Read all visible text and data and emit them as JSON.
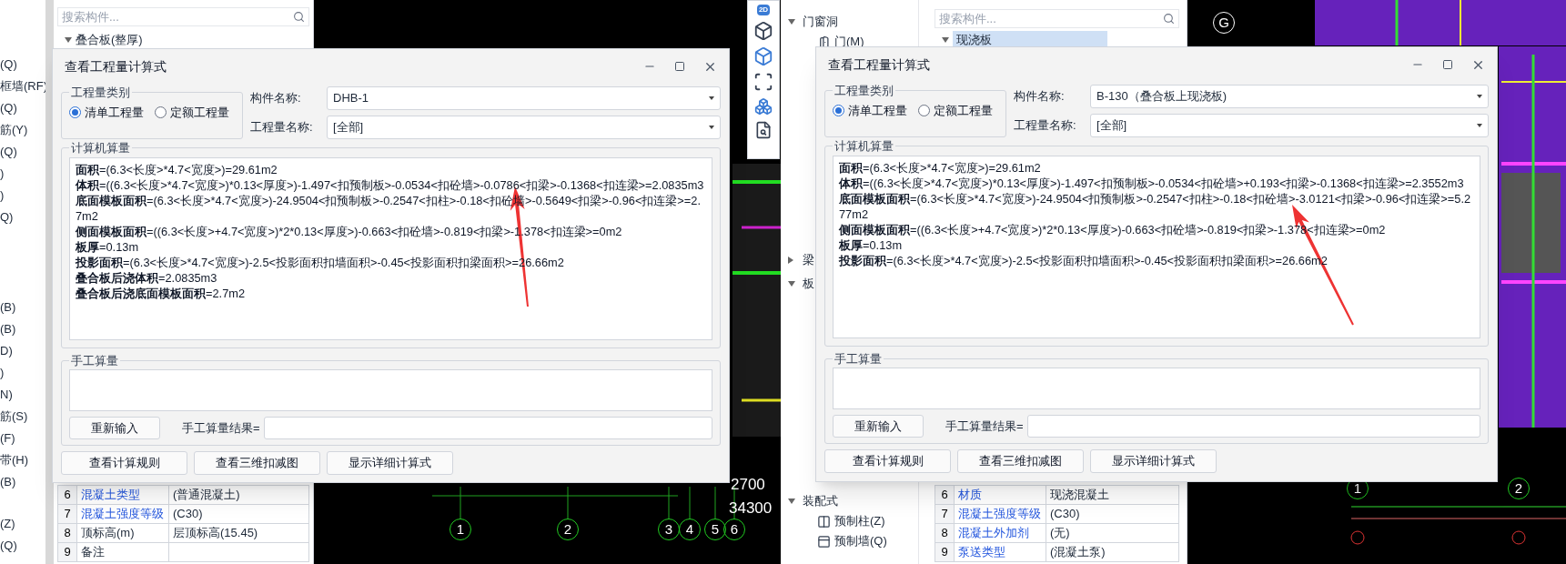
{
  "left_window": {
    "sidebar_groups": [
      [
        "(Q)",
        "框墙(RF)",
        "(Q)",
        "筋(Y)",
        "(Q)",
        ")",
        ")",
        "Q)"
      ],
      [
        "(B)",
        "(B)",
        "D)",
        ")",
        "N)",
        "筋(S)",
        "(F)",
        "带(H)",
        "(B)"
      ],
      [
        "(Z)",
        "(Q)"
      ]
    ],
    "search": {
      "placeholder": "搜索构件..."
    },
    "tree": [
      {
        "label": "叠合板(整厚)",
        "expanded": true
      }
    ],
    "properties": [
      {
        "index": "6",
        "name": "混凝土类型",
        "value": "(普通混凝土)",
        "linked": true
      },
      {
        "index": "7",
        "name": "混凝土强度等级",
        "value": "(C30)",
        "linked": true
      },
      {
        "index": "8",
        "name": "顶标高(m)",
        "value": "层顶标高(15.45)",
        "linked": false
      },
      {
        "index": "9",
        "name": "备注",
        "linked": false
      }
    ],
    "toolbar_label": "2D",
    "cad_dimensions": [
      "2700",
      "34300"
    ],
    "cad_axes": [
      "1",
      "2",
      "3",
      "4",
      "5",
      "6"
    ],
    "dialog": {
      "title": "查看工程量计算式",
      "category": {
        "title": "工程量类别",
        "options": [
          {
            "label": "清单工程量",
            "selected": true
          },
          {
            "label": "定额工程量",
            "selected": false
          }
        ]
      },
      "component_name": {
        "label": "构件名称:",
        "value": "DHB-1"
      },
      "quantity_name": {
        "label": "工程量名称:",
        "value": "[全部]"
      },
      "computed": {
        "title": "计算机算量",
        "lines": [
          {
            "term": "面积",
            "formula": "=(6.3<长度>*4.7<宽度>)=29.61m2"
          },
          {
            "term": "体积",
            "formula": "=((6.3<长度>*4.7<宽度>)*0.13<厚度>)-1.497<扣预制板>-0.0534<扣砼墙>-0.0786<扣梁>-0.1368<扣连梁>=2.0835m3"
          },
          {
            "term": "底面模板面积",
            "formula": "=(6.3<长度>*4.7<宽度>)-24.9504<扣预制板>-0.2547<扣柱>-0.18<扣砼墙>-0.5649<扣梁>-0.96<扣连梁>=2.7m2"
          },
          {
            "term": "侧面模板面积",
            "formula": "=((6.3<长度>+4.7<宽度>)*2*0.13<厚度>)-0.663<扣砼墙>-0.819<扣梁>-1.378<扣连梁>=0m2"
          },
          {
            "term": "板厚",
            "formula": "=0.13m"
          },
          {
            "term": "投影面积",
            "formula": "=(6.3<长度>*4.7<宽度>)-2.5<投影面积扣墙面积>-0.45<投影面积扣梁面积>=26.66m2"
          },
          {
            "term": "叠合板后浇体积",
            "formula": "=2.0835m3"
          },
          {
            "term": "叠合板后浇底面模板面积",
            "formula": "=2.7m2"
          }
        ]
      },
      "manual": {
        "title": "手工算量",
        "reset_button": "重新输入",
        "result_label": "手工算量结果="
      },
      "buttons": [
        "查看计算规则",
        "查看三维扣减图",
        "显示详细计算式"
      ]
    }
  },
  "right_window": {
    "tree": [
      {
        "label": "门窗洞",
        "expanded": true,
        "children": [
          {
            "label": "门(M)"
          }
        ]
      },
      {
        "label": "梁",
        "expanded": false
      },
      {
        "label": "板",
        "expanded": true
      },
      {
        "label": "装配式",
        "expanded": true,
        "children": [
          {
            "label": "预制柱(Z)"
          },
          {
            "label": "预制墙(Q)"
          }
        ]
      }
    ],
    "search": {
      "placeholder": "搜索构件..."
    },
    "components": [
      {
        "label": "现浇板",
        "selected": true
      }
    ],
    "properties": [
      {
        "index": "6",
        "name": "材质",
        "value": "现浇混凝土",
        "linked": true
      },
      {
        "index": "7",
        "name": "混凝土强度等级",
        "value": "(C30)",
        "linked": true
      },
      {
        "index": "8",
        "name": "混凝土外加剂",
        "value": "(无)",
        "linked": true
      },
      {
        "index": "9",
        "name": "泵送类型",
        "value": "(混凝土泵)",
        "linked": true
      }
    ],
    "cad_axes": [
      "G",
      "1",
      "2"
    ],
    "dialog": {
      "title": "查看工程量计算式",
      "category": {
        "title": "工程量类别",
        "options": [
          {
            "label": "清单工程量",
            "selected": true
          },
          {
            "label": "定额工程量",
            "selected": false
          }
        ]
      },
      "component_name": {
        "label": "构件名称:",
        "value": "B-130（叠合板上现浇板)"
      },
      "quantity_name": {
        "label": "工程量名称:",
        "value": "[全部]"
      },
      "computed": {
        "title": "计算机算量",
        "lines": [
          {
            "term": "面积",
            "formula": "=(6.3<长度>*4.7<宽度>)=29.61m2"
          },
          {
            "term": "体积",
            "formula": "=((6.3<长度>*4.7<宽度>)*0.13<厚度>)-1.497<扣预制板>-0.0534<扣砼墙>+0.193<扣梁>-0.1368<扣连梁>=2.3552m3"
          },
          {
            "term": "底面模板面积",
            "formula": "=(6.3<长度>*4.7<宽度>)-24.9504<扣预制板>-0.2547<扣柱>-0.18<扣砼墙>-3.0121<扣梁>-0.96<扣连梁>=5.277m2"
          },
          {
            "term": "侧面模板面积",
            "formula": "=((6.3<长度>+4.7<宽度>)*2*0.13<厚度>)-0.663<扣砼墙>-0.819<扣梁>-1.378<扣连梁>=0m2"
          },
          {
            "term": "板厚",
            "formula": "=0.13m"
          },
          {
            "term": "投影面积",
            "formula": "=(6.3<长度>*4.7<宽度>)-2.5<投影面积扣墙面积>-0.45<投影面积扣梁面积>=26.66m2"
          }
        ]
      },
      "manual": {
        "title": "手工算量",
        "reset_button": "重新输入",
        "result_label": "手工算量结果="
      },
      "buttons": [
        "查看计算规则",
        "查看三维扣减图",
        "显示详细计算式"
      ]
    }
  }
}
